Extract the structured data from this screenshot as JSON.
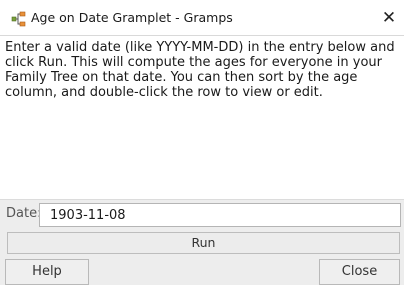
{
  "window": {
    "title": "Age on Date Gramplet - Gramps",
    "close_symbol": "✕",
    "icon": "gramps-tree-icon"
  },
  "content": {
    "description": "Enter a valid date (like YYYY-MM-DD) in the entry below and\nclick Run. This will compute the ages for everyone in your\nFamily Tree on that date. You can then sort by the age\ncolumn, and double-click the row to view or edit."
  },
  "date_field": {
    "label": "Date:",
    "value": "1903-11-08"
  },
  "buttons": {
    "run": "Run",
    "help": "Help",
    "close": "Close"
  },
  "colors": {
    "background": "#ededed",
    "text_panel": "#ffffff",
    "icon_orange": "#e8913a",
    "icon_green": "#7aa03a"
  }
}
